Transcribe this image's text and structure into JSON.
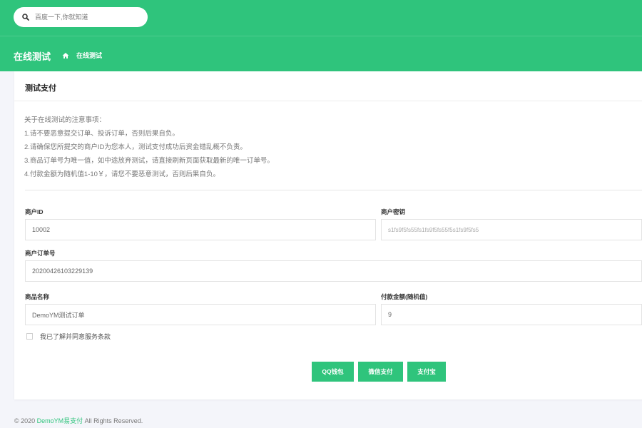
{
  "search": {
    "placeholder": "百度一下,你就知道"
  },
  "header": {
    "page_title": "在线测试",
    "breadcrumb": "在线测试"
  },
  "card": {
    "title": "测试支付",
    "notes": [
      "关于在线测试的注意事项：",
      "1.请不要恶意提交订单、投诉订单，否则后果自负。",
      "2.请确保您所提交的商户ID为您本人，测试支付成功后资金错乱概不负责。",
      "3.商品订单号为唯一值，如中途放弃测试，请直接刷新页面获取最新的唯一订单号。",
      "4.付款金额为随机值1-10￥，请您不要恶意测试，否则后果自负。"
    ]
  },
  "form": {
    "merchant_id": {
      "label": "商户ID",
      "value": "10002"
    },
    "merchant_key": {
      "label": "商户密钥",
      "value": "s1fs9f5fs55fs1fs9f5fs55f5s1fs9f5fs5"
    },
    "order_no": {
      "label": "商户订单号",
      "value": "20200426103229139"
    },
    "product_name": {
      "label": "商品名称",
      "value": "DemoYM测试订单"
    },
    "amount": {
      "label": "付款金额(随机值)",
      "value": "9"
    },
    "agree_text": "我已了解并同意服务条款"
  },
  "buttons": {
    "qq": "QQ钱包",
    "wechat": "微信支付",
    "alipay": "支付宝"
  },
  "footer": {
    "prefix": "© 2020 ",
    "brand": "DemoYM易支付",
    "suffix": " All Rights Reserved."
  },
  "colors": {
    "accent": "#2fc47c",
    "background": "#f4f5fa"
  }
}
